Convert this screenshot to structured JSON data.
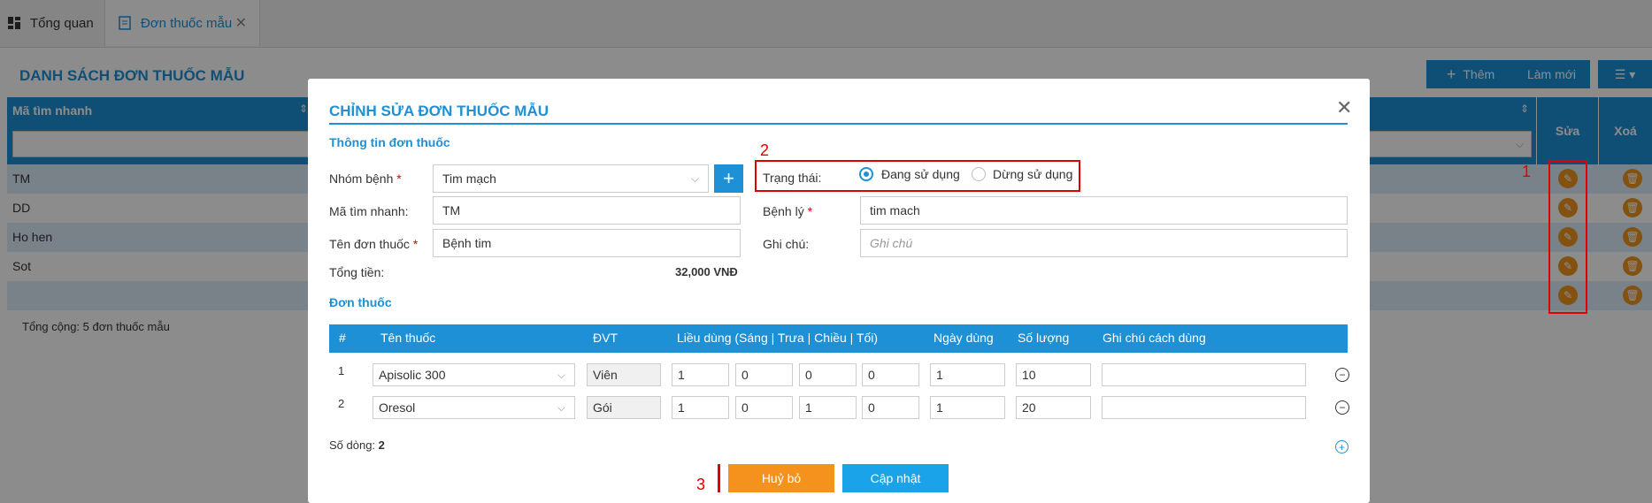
{
  "tabs": [
    {
      "label": "Tổng quan"
    },
    {
      "label": "Đơn thuốc mẫu"
    }
  ],
  "list": {
    "title": "DANH SÁCH ĐƠN THUỐC MẪU",
    "add_label": "Thêm",
    "refresh_label": "Làm mới",
    "col_ma": "Mã tìm nhanh",
    "col_sua": "Sửa",
    "col_xoa": "Xoá",
    "rows": [
      "TM",
      "DD",
      "Ho hen",
      "Sot",
      ""
    ],
    "total": "Tổng cộng: 5 đơn thuốc mẫu"
  },
  "modal": {
    "title": "CHỈNH SỬA ĐƠN THUỐC MẪU",
    "section_info": "Thông tin đơn thuốc",
    "nhom_benh_label": "Nhóm bệnh",
    "nhom_benh_value": "Tim mạch",
    "ma_label": "Mã tìm nhanh",
    "ma_value": "TM",
    "ten_label": "Tên đơn thuốc",
    "ten_value": "Bệnh tim",
    "tong_tien_label": "Tổng tiền:",
    "tong_tien_value": "32,000 VNĐ",
    "trang_thai_label": "Trạng thái",
    "status_options": [
      "Đang sử dụng",
      "Dừng sử dụng"
    ],
    "status_selected": "Đang sử dụng",
    "benh_ly_label": "Bệnh lý",
    "benh_ly_value": "tim mach",
    "ghi_chu_label": "Ghi chú",
    "ghi_chu_placeholder": "Ghi chú",
    "section_drugs": "Đơn thuốc",
    "drug_cols": [
      "#",
      "Tên thuốc",
      "ĐVT",
      "Liều dùng (Sáng | Trưa | Chiều | Tối)",
      "Ngày dùng",
      "Số lượng",
      "Ghi chú cách dùng"
    ],
    "drugs": [
      {
        "no": "1",
        "name": "Apisolic 300",
        "unit": "Viên",
        "sang": "1",
        "trua": "0",
        "chieu": "0",
        "toi": "0",
        "ngay": "1",
        "so_luong": "10",
        "ghi_chu": ""
      },
      {
        "no": "2",
        "name": "Oresol",
        "unit": "Gói",
        "sang": "1",
        "trua": "0",
        "chieu": "1",
        "toi": "0",
        "ngay": "1",
        "so_luong": "20",
        "ghi_chu": ""
      }
    ],
    "so_dong_label": "Số dòng:",
    "so_dong_value": "2",
    "cancel_label": "Huỷ bỏ",
    "update_label": "Cập nhật"
  },
  "annotations": {
    "a1": "1",
    "a2": "2",
    "a3": "3"
  },
  "colors": {
    "primary": "#1e90d6",
    "orange": "#f5921e",
    "annotation": "#e10000"
  }
}
